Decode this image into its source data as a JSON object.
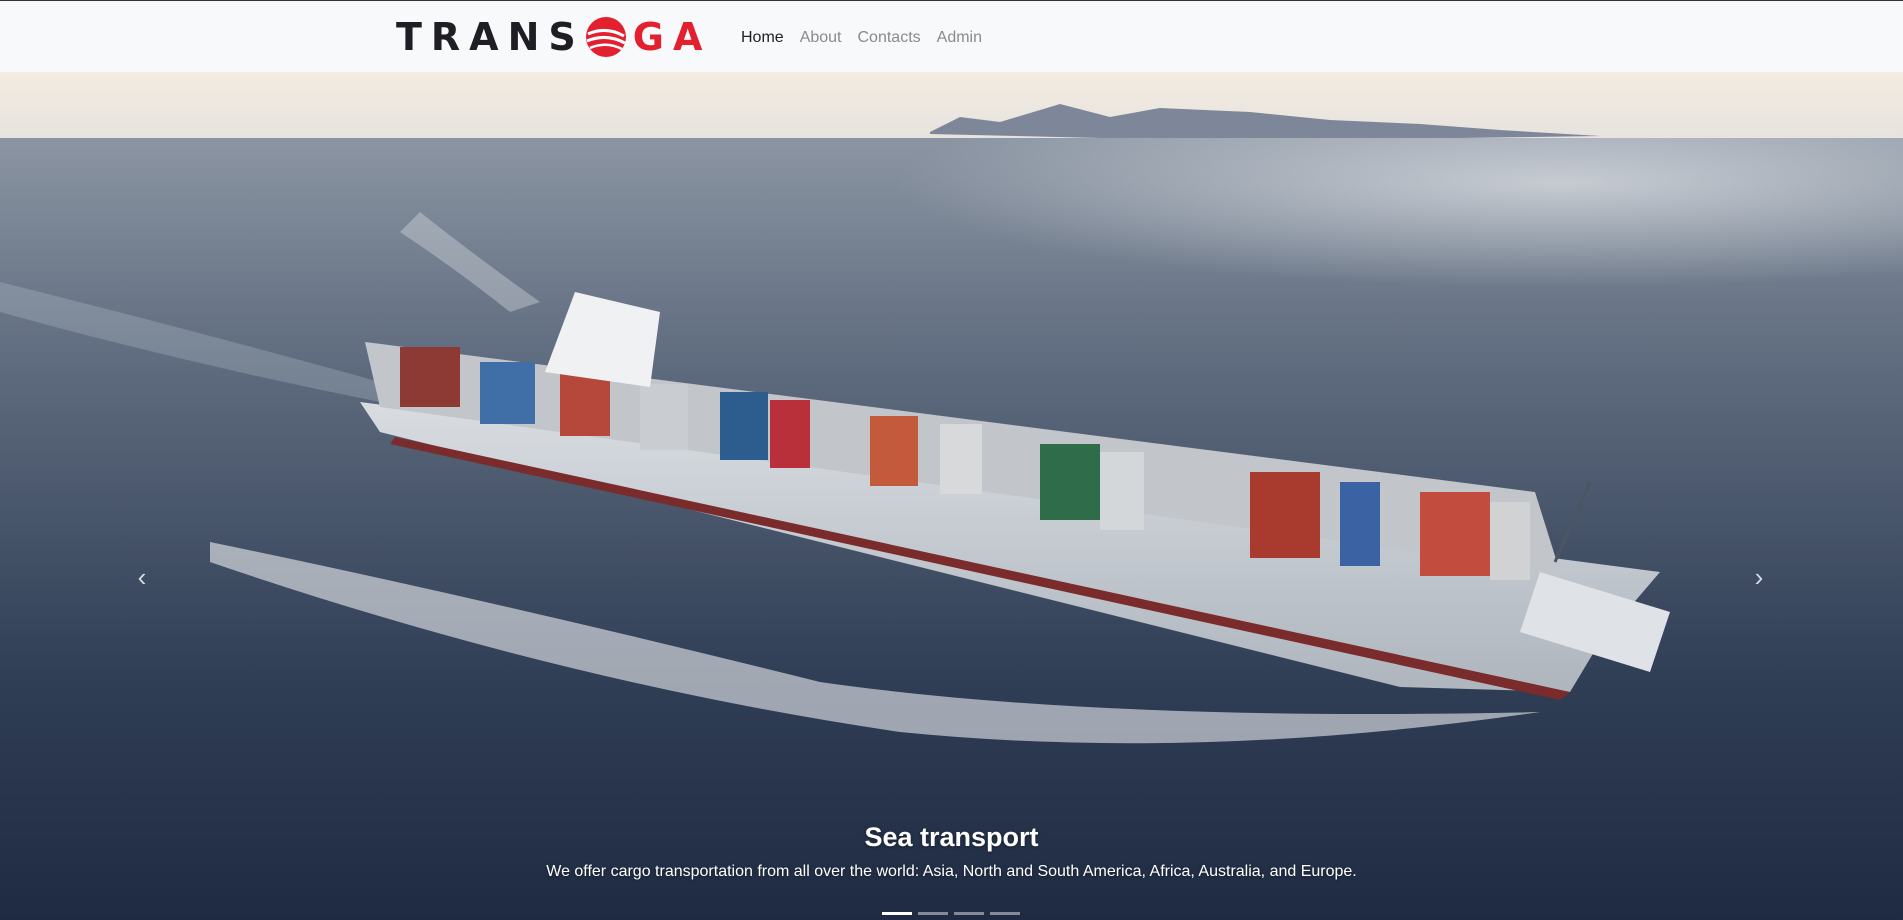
{
  "brand": {
    "part1": "TRANS",
    "part2": "GA",
    "logo_icon": "globe-icon",
    "colors": {
      "dark": "#1e1e24",
      "red": "#e3202f"
    }
  },
  "nav": {
    "items": [
      {
        "label": "Home",
        "active": true
      },
      {
        "label": "About",
        "active": false
      },
      {
        "label": "Contacts",
        "active": false
      },
      {
        "label": "Admin",
        "active": false
      }
    ]
  },
  "carousel": {
    "prev_icon": "chevron-left-icon",
    "next_icon": "chevron-right-icon",
    "slide": {
      "title": "Sea transport",
      "text": "We offer cargo transportation from all over the world: Asia, North and South America, Africa, Australia, and Europe.",
      "image": "container-ship-at-sea"
    },
    "indicator_count": 4,
    "active_index": 0
  }
}
